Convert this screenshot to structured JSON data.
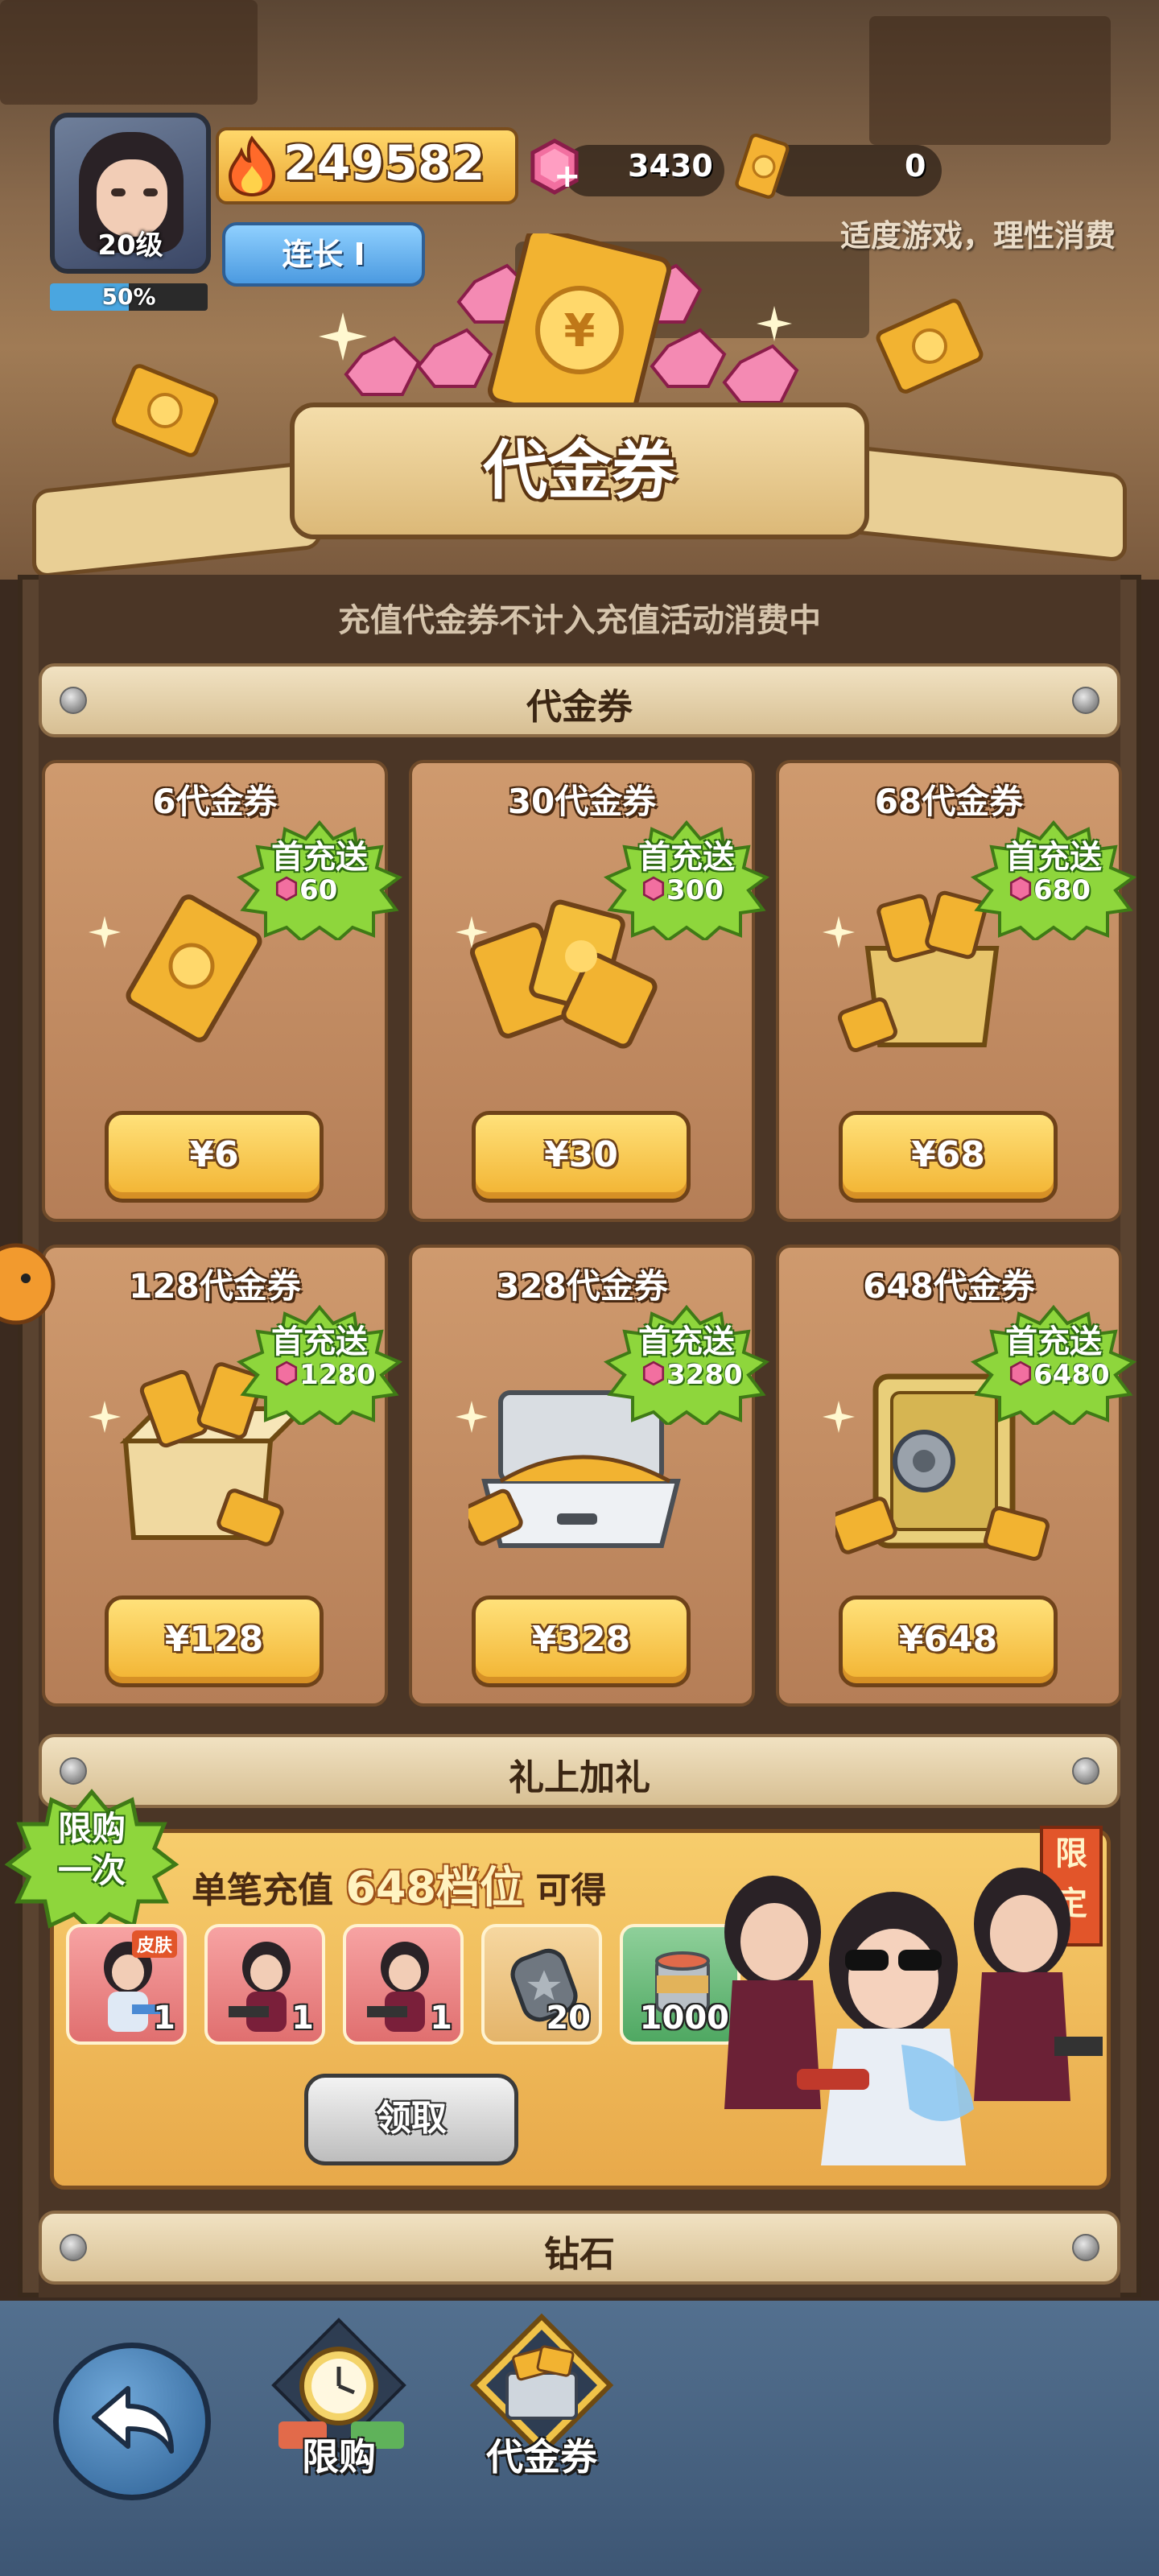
{
  "player": {
    "level": "20级",
    "exp_percent": "50%",
    "exp_fraction": 0.5,
    "power": "249582",
    "rank": "连长 I"
  },
  "resources": {
    "gems": "3430",
    "vouchers": "0"
  },
  "notice": "适度游戏，理性消费",
  "page_title": "代金券",
  "subnote": "充值代金券不计入充值活动消费中",
  "section_voucher": "代金券",
  "first_recharge_label": "首充送",
  "cards": [
    {
      "name": "6代金券",
      "bonus": "60",
      "price": "¥6"
    },
    {
      "name": "30代金券",
      "bonus": "300",
      "price": "¥30"
    },
    {
      "name": "68代金券",
      "bonus": "680",
      "price": "¥68"
    },
    {
      "name": "128代金券",
      "bonus": "1280",
      "price": "¥128"
    },
    {
      "name": "328代金券",
      "bonus": "3280",
      "price": "¥328"
    },
    {
      "name": "648代金券",
      "bonus": "6480",
      "price": "¥648"
    }
  ],
  "gift": {
    "section_title": "礼上加礼",
    "limit_once": [
      "限购",
      "一次"
    ],
    "limited_tag": [
      "限",
      "定"
    ],
    "title_pre": "单笔充值",
    "title_highlight": "648档位",
    "title_post": "可得",
    "skin_tag": "皮肤",
    "items": [
      {
        "icon": "character-skin-icon",
        "count": "1"
      },
      {
        "icon": "character-icon",
        "count": "1"
      },
      {
        "icon": "character-icon",
        "count": "1"
      },
      {
        "icon": "dog-tag-icon",
        "count": "20"
      },
      {
        "icon": "canned-food-icon",
        "count": "1000"
      }
    ],
    "claim_label": "领取"
  },
  "section_diamond": "钻石",
  "nav": {
    "back_icon": "back-arrow-icon",
    "tabs": [
      {
        "label": "限购",
        "icon": "stopwatch-icon"
      },
      {
        "label": "代金券",
        "icon": "voucher-box-icon"
      }
    ]
  },
  "colors": {
    "gold": "#f2b331",
    "badge_green": "#8ed63c",
    "panel_brown": "#4b3626"
  }
}
